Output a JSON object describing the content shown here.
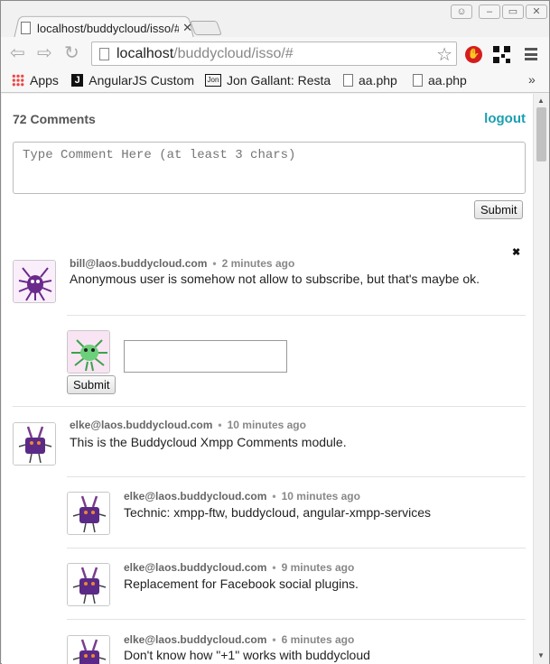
{
  "browser": {
    "tab_title": "localhost/buddycloud/isso/#",
    "url_host": "localhost",
    "url_path": "/buddycloud/isso/#",
    "bookmarks": [
      {
        "label": "Apps",
        "icon": "apps-grid-icon"
      },
      {
        "label": "AngularJS Custom",
        "icon": "j-logo-icon"
      },
      {
        "label": "Jon Gallant: Resta",
        "icon": "jon-logo-icon"
      },
      {
        "label": "aa.php",
        "icon": "page-icon"
      },
      {
        "label": "aa.php",
        "icon": "page-icon"
      }
    ],
    "bookmarks_more": "»"
  },
  "header": {
    "count_label": "72 Comments",
    "logout_label": "logout"
  },
  "composer": {
    "placeholder": "Type Comment Here (at least 3 chars)",
    "submit_label": "Submit"
  },
  "comments": [
    {
      "author": "bill@laos.buddycloud.com",
      "time": "2 minutes ago",
      "text": "Anonymous user is somehow not allow to subscribe, but that's maybe ok.",
      "close": "✖",
      "reply_submit_label": "Submit"
    },
    {
      "author": "elke@laos.buddycloud.com",
      "time": "10 minutes ago",
      "text": "This is the Buddycloud Xmpp Comments module.",
      "replies": [
        {
          "author": "elke@laos.buddycloud.com",
          "time": "10 minutes ago",
          "text": "Technic: xmpp-ftw, buddycloud, angular-xmpp-services"
        },
        {
          "author": "elke@laos.buddycloud.com",
          "time": "9 minutes ago",
          "text": "Replacement for Facebook social plugins."
        },
        {
          "author": "elke@laos.buddycloud.com",
          "time": "6 minutes ago",
          "text": "Don't know how \"+1\" works with buddycloud"
        }
      ]
    }
  ],
  "separator": "•",
  "colors": {
    "accent": "#1a9fb0",
    "avatar_purple": "#5b2a86",
    "avatar_green": "#6ccf7a"
  }
}
